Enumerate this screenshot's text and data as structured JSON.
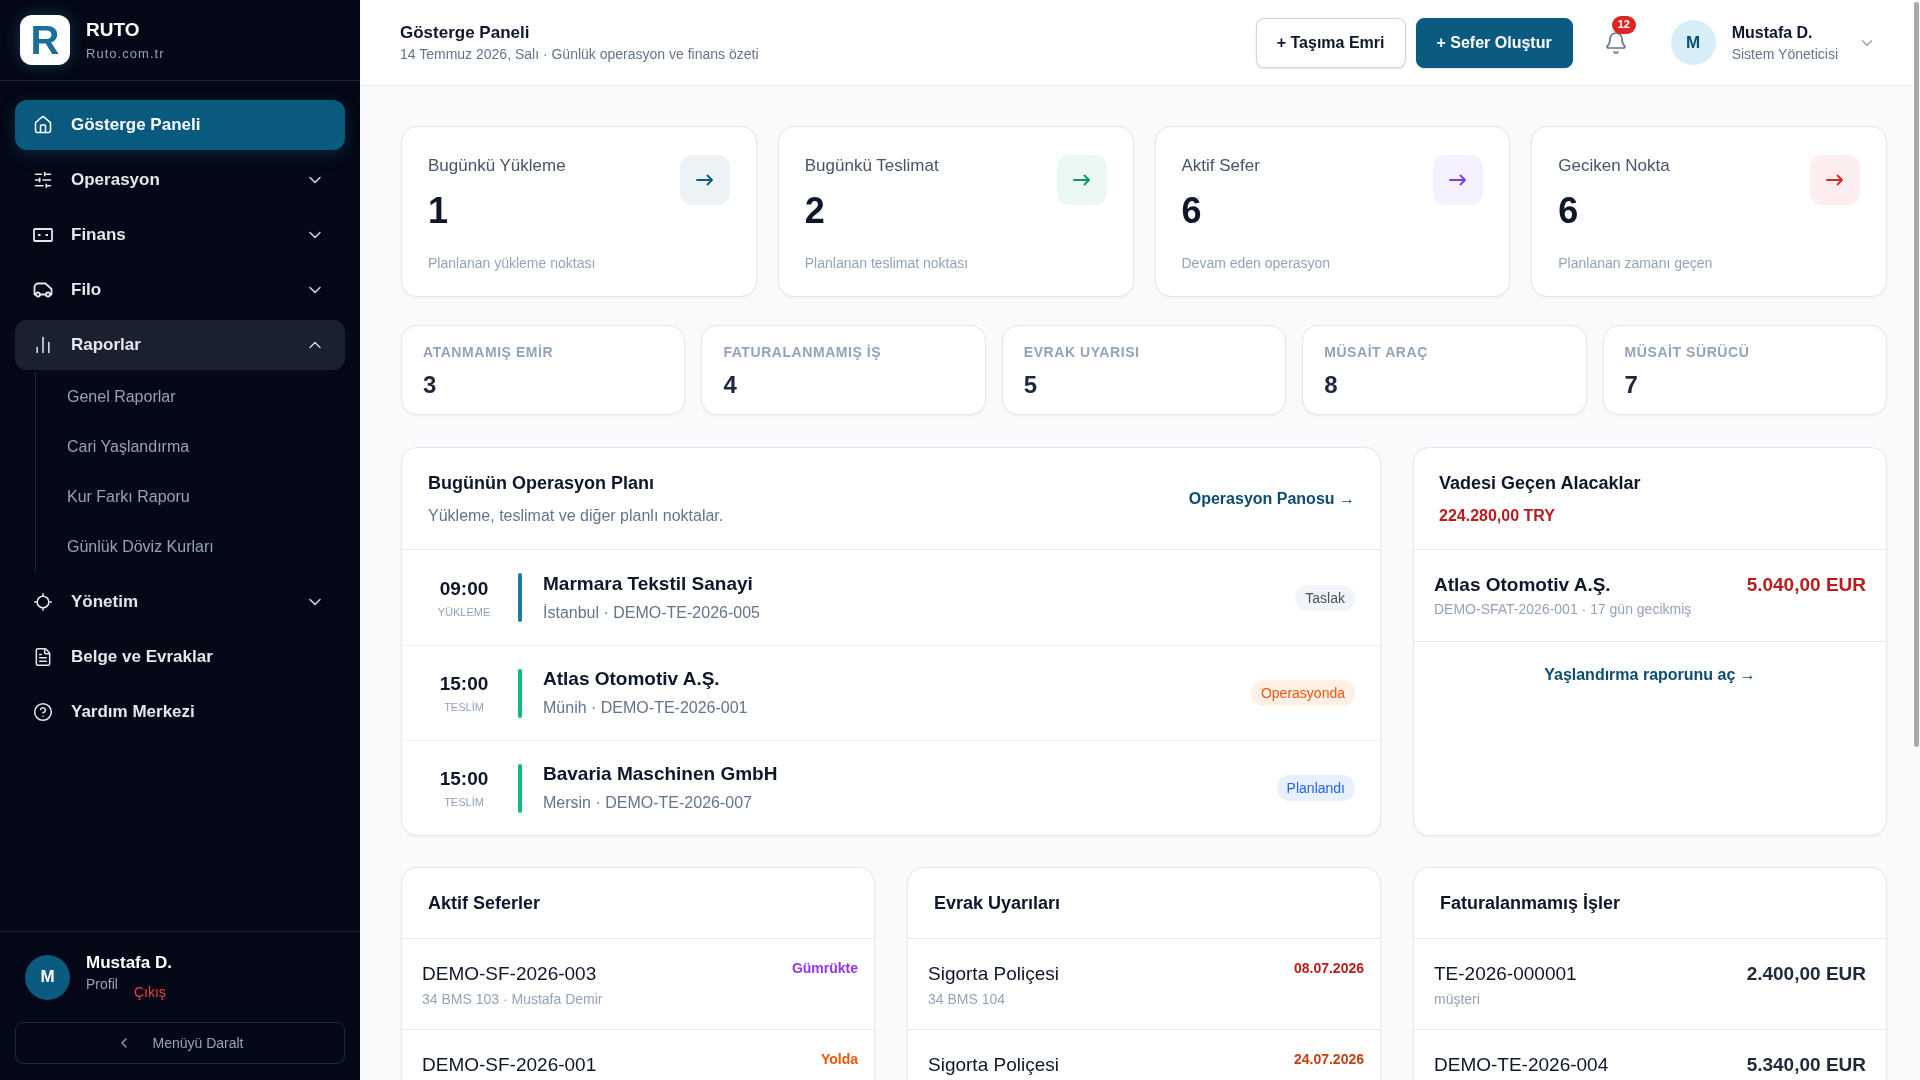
{
  "sidebar": {
    "brand": {
      "logo_letter": "R",
      "name": "RUTO",
      "domain": "Ruto.com.tr"
    },
    "nav": [
      {
        "label": "Gösterge Paneli",
        "selected": true
      },
      {
        "label": "Operasyon",
        "selected": false,
        "expanded": false
      },
      {
        "label": "Finans",
        "selected": false,
        "expanded": false
      },
      {
        "label": "Filo",
        "selected": false,
        "expanded": false
      },
      {
        "label": "Raporlar",
        "selected": false,
        "expanded": true,
        "children": [
          {
            "label": "Genel Raporlar",
            "selected": false
          },
          {
            "label": "Cari Yaşlandırma",
            "selected": false
          },
          {
            "label": "Kur Farkı Raporu",
            "selected": false
          },
          {
            "label": "Günlük Döviz Kurları",
            "selected": false
          }
        ]
      },
      {
        "label": "Yönetim",
        "selected": false,
        "expanded": false
      },
      {
        "label": "Belge ve Evraklar",
        "selected": false
      },
      {
        "label": "Yardım Merkezi",
        "selected": false
      }
    ],
    "user": {
      "avatar_initial": "M",
      "name": "Mustafa D.",
      "profile_link": "Profil",
      "logout_link": "Çıkış"
    },
    "collapse_button": "Menüyü Daralt"
  },
  "header": {
    "title": "Gösterge Paneli",
    "subtitle": "14 Temmuz 2026, Salı · Günlük operasyon ve finans özeti",
    "buttons": [
      {
        "label": "+ Taşıma Emri",
        "kind": "secondary"
      },
      {
        "label": "+ Sefer Oluştur",
        "kind": "primary"
      }
    ],
    "notifications": {
      "count": "12"
    },
    "user": {
      "avatar_initial": "M",
      "name": "Mustafa D.",
      "role": "Sistem Yöneticisi"
    }
  },
  "summary_cards": [
    {
      "title": "Bugünkü Yükleme",
      "value": "1",
      "description": "Planlanan yükleme noktası",
      "color": "#0b5a80"
    },
    {
      "title": "Bugünkü Teslimat",
      "value": "2",
      "description": "Planlanan teslimat noktası",
      "color": "#059669"
    },
    {
      "title": "Aktif Sefer",
      "value": "6",
      "description": "Devam eden operasyon",
      "color": "#7c3aed"
    },
    {
      "title": "Geciken Nokta",
      "value": "6",
      "description": "Planlanan zamanı geçen",
      "color": "#dc2626"
    }
  ],
  "metrics": [
    {
      "label": "ATANMAMIŞ EMİR",
      "value": "3"
    },
    {
      "label": "FATURALANMAMIŞ İŞ",
      "value": "4"
    },
    {
      "label": "EVRAK UYARISI",
      "value": "5"
    },
    {
      "label": "MÜSAİT ARAÇ",
      "value": "8"
    },
    {
      "label": "MÜSAİT SÜRÜCÜ",
      "value": "7"
    }
  ],
  "operation_plan": {
    "title": "Bugünün Operasyon Planı",
    "subtitle": "Yükleme, teslimat ve diğer planlı noktalar.",
    "link": "Operasyon Panosu →",
    "items": [
      {
        "time": "09:00",
        "type_label": "YÜKLEME",
        "kind": "loading",
        "company": "Marmara Tekstil Sanayi",
        "details": "İstanbul · DEMO-TE-2026-005",
        "status": {
          "label": "Taslak",
          "kind": "draft"
        }
      },
      {
        "time": "15:00",
        "type_label": "TESLİM",
        "kind": "delivery",
        "company": "Atlas Otomotiv A.Ş.",
        "details": "Münih · DEMO-TE-2026-001",
        "status": {
          "label": "Operasyonda",
          "kind": "in_operation"
        }
      },
      {
        "time": "15:00",
        "type_label": "TESLİM",
        "kind": "delivery",
        "company": "Bavaria Maschinen GmbH",
        "details": "Mersin · DEMO-TE-2026-007",
        "status": {
          "label": "Planlandı",
          "kind": "planned"
        }
      }
    ]
  },
  "overdue_receivables": {
    "title": "Vadesi Geçen Alacaklar",
    "total": "224.280,00 TRY",
    "items": [
      {
        "company": "Atlas Otomotiv A.Ş.",
        "details": "DEMO-SFAT-2026-001 · 17 gün gecikmiş",
        "amount": "5.040,00 EUR"
      }
    ],
    "link": "Yaşlandırma raporunu aç →"
  },
  "active_trips": {
    "title": "Aktif Seferler",
    "items": [
      {
        "code": "DEMO-SF-2026-003",
        "details": "34 BMS 103 · Mustafa Demir",
        "status": "Gümrükte",
        "color": "#9333ea"
      },
      {
        "code": "DEMO-SF-2026-001",
        "status": "Yolda",
        "color": "#ea580c"
      }
    ]
  },
  "document_alerts": {
    "title": "Evrak Uyarıları",
    "items": [
      {
        "name": "Sigorta Poliçesi",
        "details": "34 BMS 104",
        "date": "08.07.2026",
        "color": "#b91c1c"
      },
      {
        "name": "Sigorta Poliçesi",
        "date": "24.07.2026",
        "color": "#c2410c"
      }
    ]
  },
  "uninvoiced_jobs": {
    "title": "Faturalanmamış İşler",
    "items": [
      {
        "code": "TE-2026-000001",
        "details": "müşteri",
        "amount": "2.400,00 EUR"
      },
      {
        "code": "DEMO-TE-2026-004",
        "amount": "5.340,00 EUR"
      }
    ]
  }
}
